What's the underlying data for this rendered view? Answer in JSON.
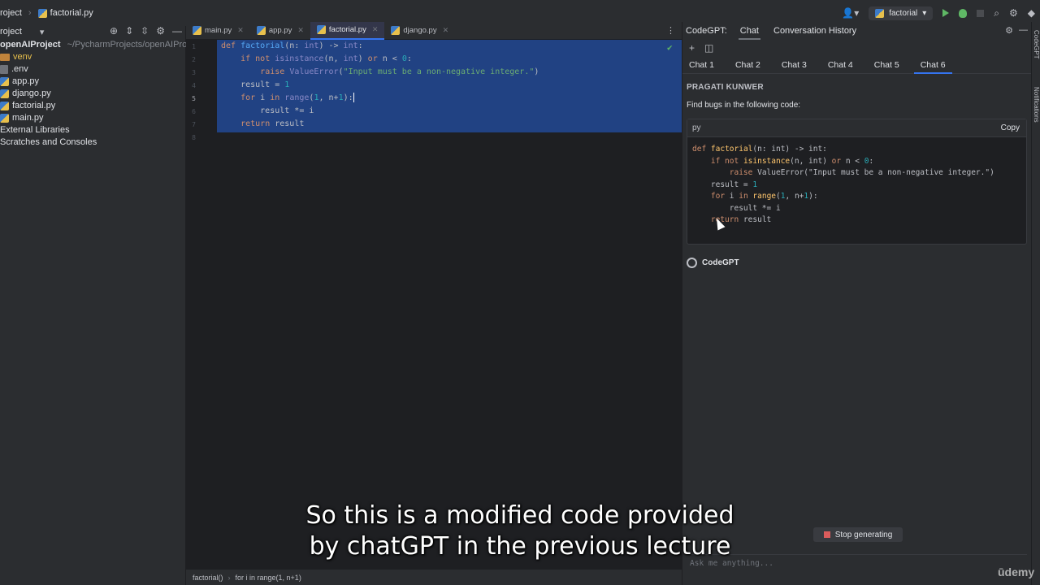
{
  "topbar": {
    "project": "roject",
    "file": "factorial.py",
    "run_config": "factorial"
  },
  "project_panel": {
    "title": "roject",
    "items": [
      {
        "name": "openAIProject",
        "path": "~/PycharmProjects/openAIProject",
        "kind": "root"
      },
      {
        "name": "venv",
        "kind": "folder"
      },
      {
        "name": ".env",
        "kind": "file"
      },
      {
        "name": "app.py",
        "kind": "py"
      },
      {
        "name": "django.py",
        "kind": "py"
      },
      {
        "name": "factorial.py",
        "kind": "py"
      },
      {
        "name": "main.py",
        "kind": "py"
      },
      {
        "name": "External Libraries",
        "kind": "lib"
      },
      {
        "name": "Scratches and Consoles",
        "kind": "scratch"
      }
    ]
  },
  "editor": {
    "tabs": [
      {
        "label": "main.py",
        "active": false
      },
      {
        "label": "app.py",
        "active": false
      },
      {
        "label": "factorial.py",
        "active": true
      },
      {
        "label": "django.py",
        "active": false
      }
    ],
    "line_numbers": [
      "1",
      "2",
      "3",
      "4",
      "5",
      "6",
      "7",
      "8"
    ],
    "current_line": "5"
  },
  "statusbar": {
    "scope1": "factorial()",
    "scope2": "for i in range(1, n+1)"
  },
  "codegpt": {
    "label": "CodeGPT:",
    "tabs": [
      "Chat",
      "Conversation History"
    ],
    "chat_tabs": [
      "Chat 1",
      "Chat 2",
      "Chat 3",
      "Chat 4",
      "Chat 5",
      "Chat 6"
    ],
    "active_chat": "Chat 6",
    "user_name": "PRAGATI KUNWER",
    "user_message": "Find bugs in the following code:",
    "code_lang": "py",
    "copy_label": "Copy",
    "bot_name": "CodeGPT",
    "stop_label": "Stop generating",
    "ask_placeholder": "Ask me anything..."
  },
  "right_strip": [
    "CodeGPT",
    "Notifications"
  ],
  "subtitle": {
    "line1": "So this is a modified code provided",
    "line2": "by chatGPT in the previous lecture"
  },
  "watermark": "ūdemy"
}
